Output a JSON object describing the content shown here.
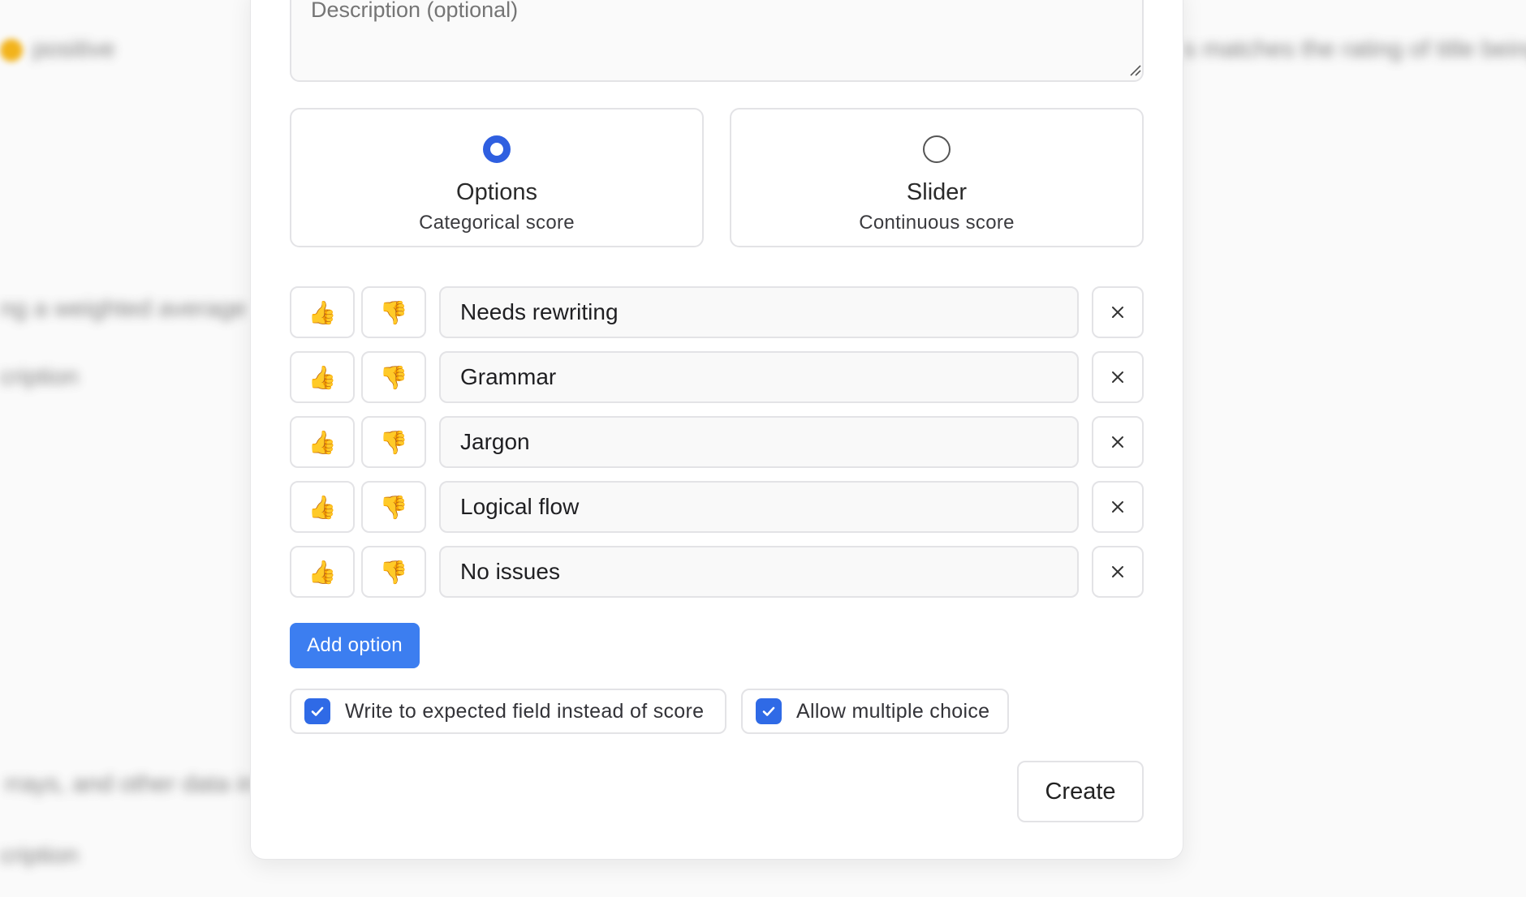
{
  "background": {
    "texts": [
      "positive",
      "s matches the rating of title being",
      "ng a weighted average",
      "cription",
      "rrays, and other data in",
      "cription"
    ]
  },
  "form": {
    "description_placeholder": "Description (optional)",
    "score_types": [
      {
        "title": "Options",
        "subtitle": "Categorical score",
        "selected": true
      },
      {
        "title": "Slider",
        "subtitle": "Continuous score",
        "selected": false
      }
    ],
    "options": [
      {
        "label": "Needs rewriting"
      },
      {
        "label": "Grammar"
      },
      {
        "label": "Jargon"
      },
      {
        "label": "Logical flow"
      },
      {
        "label": "No issues"
      }
    ],
    "thumbs_up_glyph": "👍",
    "thumbs_down_glyph": "👎",
    "add_option_label": "Add option",
    "checkboxes": [
      {
        "label": "Write to expected field instead of score",
        "checked": true
      },
      {
        "label": "Allow multiple choice",
        "checked": true
      }
    ],
    "create_label": "Create"
  },
  "colors": {
    "accent": "#3c7ef0",
    "radio_selected": "#2f5fe0",
    "checkbox": "#2f6ae6"
  }
}
